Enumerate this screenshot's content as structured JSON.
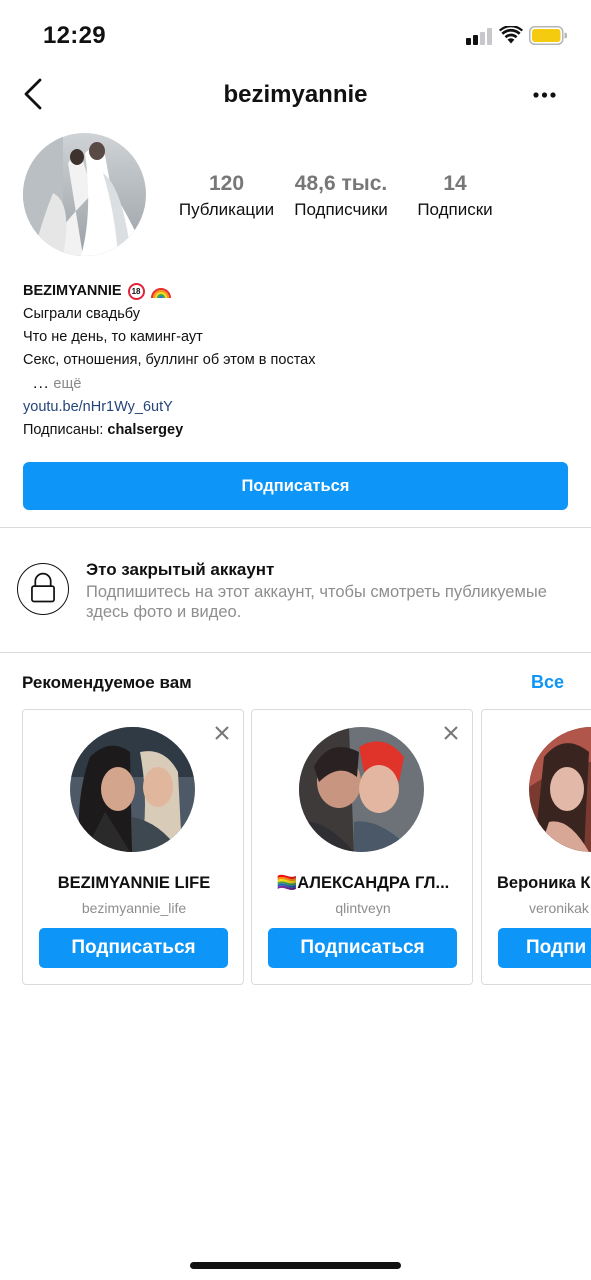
{
  "status_bar": {
    "time": "12:29"
  },
  "header": {
    "username": "bezimyannie"
  },
  "stats": [
    {
      "value": "120",
      "label": "Публикации"
    },
    {
      "value": "48,6 тыс.",
      "label": "Подписчики"
    },
    {
      "value": "14",
      "label": "Подписки"
    }
  ],
  "bio": {
    "name": "BEZIMYANNIE",
    "name_badge": "18",
    "lines": [
      "Сыграли свадьбу",
      "Что не день, то каминг-аут",
      "Секс, отношения, буллинг об этом в постах"
    ],
    "ellipsis": "...",
    "more": "ещё",
    "link": "youtu.be/nHr1Wy_6utY",
    "followed_by_prefix": "Подписаны:",
    "followed_by_user": "chalsergey"
  },
  "follow_button": "Подписаться",
  "private": {
    "title": "Это закрытый аккаунт",
    "description": "Подпишитесь на этот аккаунт, чтобы смотреть публикуемые здесь фото и видео."
  },
  "recommended": {
    "title": "Рекомендуемое вам",
    "see_all": "Все",
    "cards": [
      {
        "name": "BEZIMYANNIE LIFE",
        "handle": "bezimyannie_life",
        "button": "Подписаться"
      },
      {
        "name": "🏳️‍🌈АЛЕКСАНДРА ГЛ...",
        "handle": "qlintveyn",
        "button": "Подписаться"
      },
      {
        "name": "Вероника К",
        "handle": "veronikak",
        "button": "Подпи"
      }
    ]
  },
  "colors": {
    "accent": "#0d95f7",
    "link": "#25457a",
    "muted": "#8e8e8e",
    "divider": "#dbdbdb"
  }
}
